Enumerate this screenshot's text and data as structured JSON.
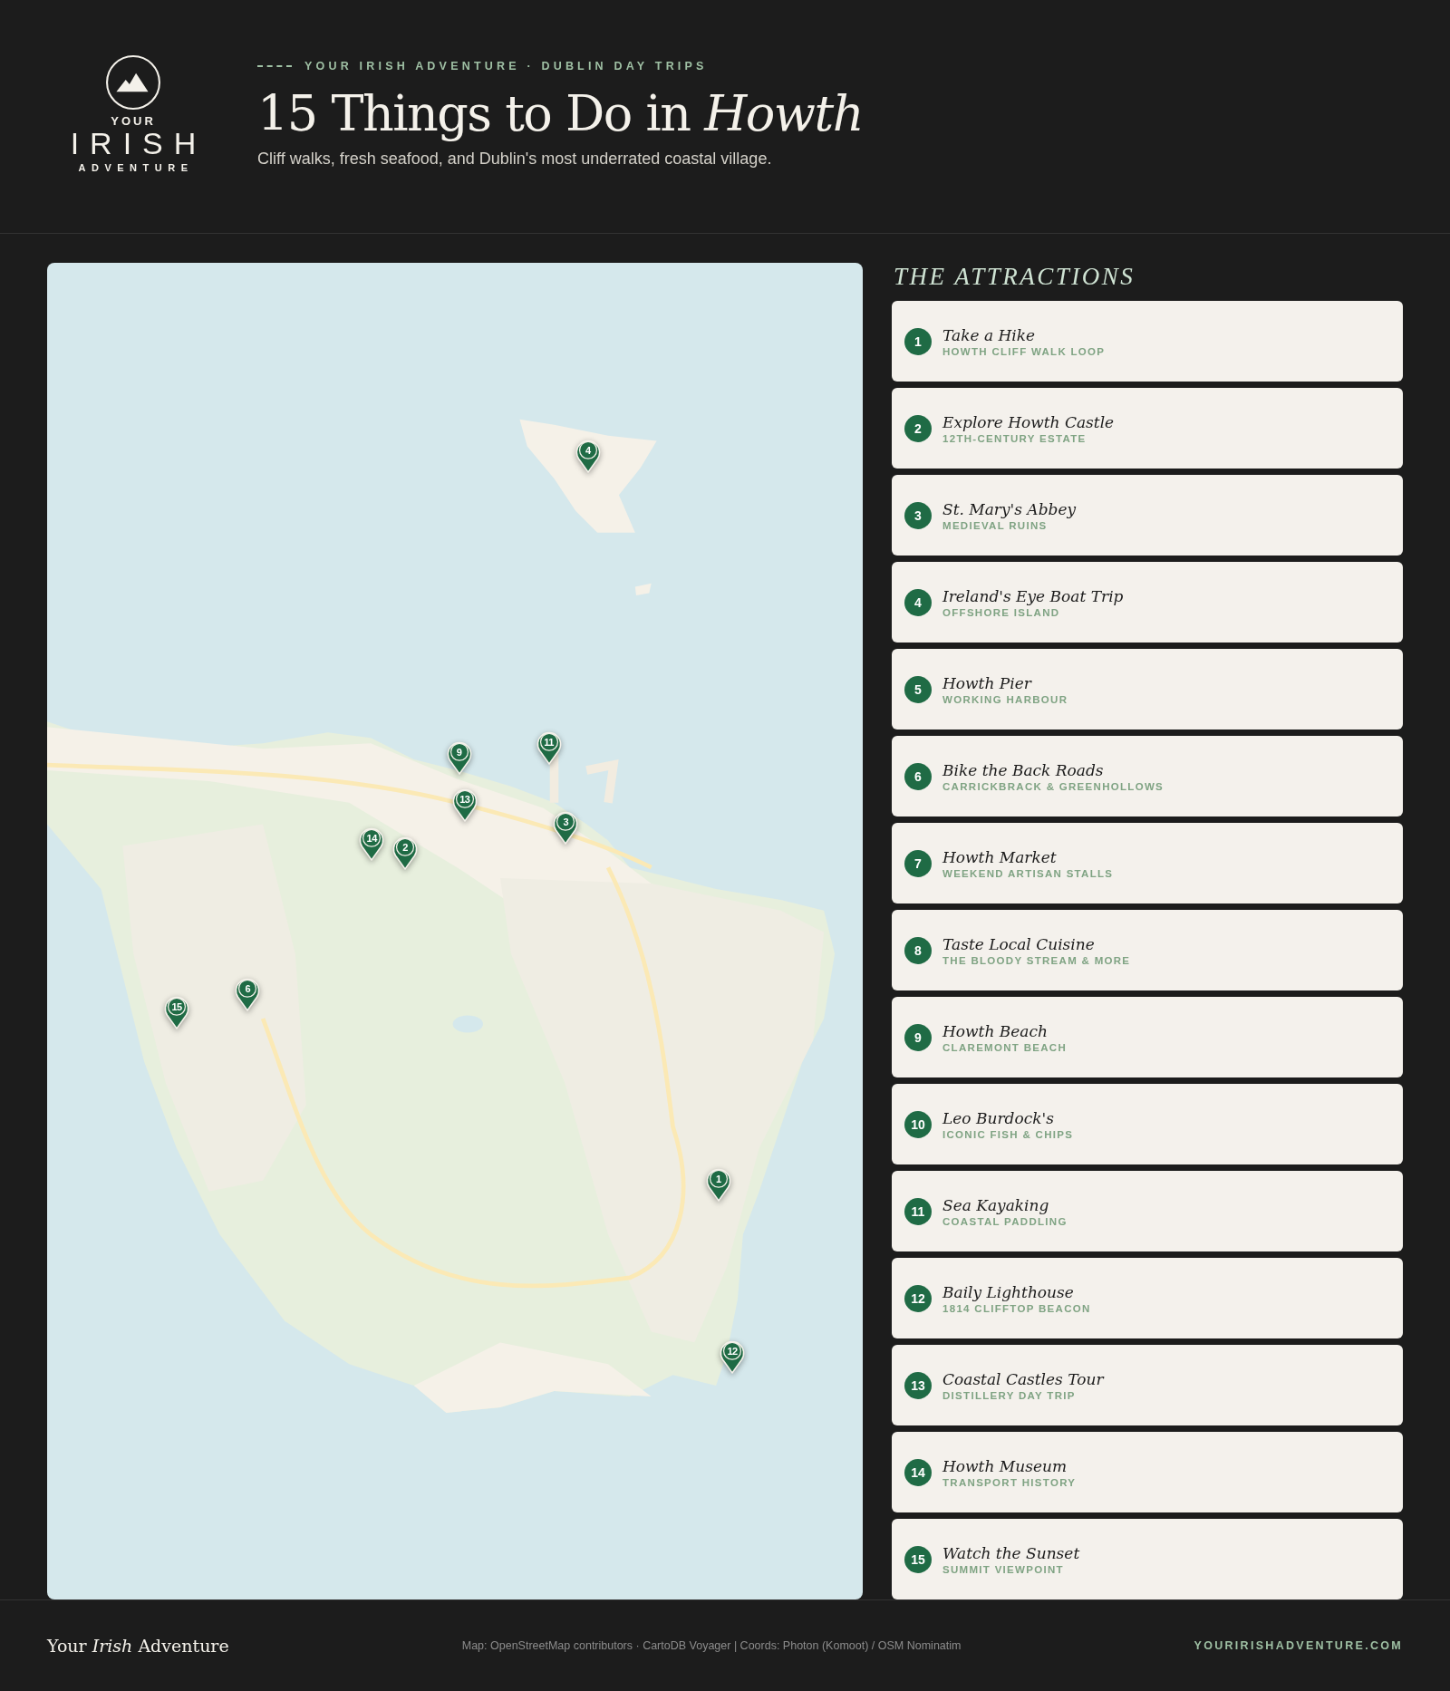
{
  "header": {
    "logo": {
      "top": "YOUR",
      "middle": "IRISH",
      "bottom": "ADVENTURE"
    },
    "eyebrow": "YOUR IRISH ADVENTURE · DUBLIN DAY TRIPS",
    "title": "15 Things to Do in *Howth*",
    "subtitle": "Cliff walks, fresh seafood, and Dublin's most underrated coastal village."
  },
  "map": {
    "kind": "picture",
    "pins": [
      {
        "label": "4"
      },
      {
        "label": "11"
      },
      {
        "label": "9"
      },
      {
        "label": "13"
      },
      {
        "label": "3"
      },
      {
        "label": "2"
      },
      {
        "label": "14"
      },
      {
        "label": "15"
      },
      {
        "label": "6"
      },
      {
        "label": "1"
      },
      {
        "label": "12"
      }
    ]
  },
  "attractions_heading": "THE ATTRACTIONS",
  "attractions": [
    {
      "number": "1",
      "name": "Take a Hike",
      "detail": "HOWTH CLIFF WALK LOOP"
    },
    {
      "number": "2",
      "name": "Explore Howth Castle",
      "detail": "12TH-CENTURY ESTATE"
    },
    {
      "number": "3",
      "name": "St. Mary's Abbey",
      "detail": "MEDIEVAL RUINS"
    },
    {
      "number": "4",
      "name": "Ireland's Eye Boat Trip",
      "detail": "OFFSHORE ISLAND"
    },
    {
      "number": "5",
      "name": "Howth Pier",
      "detail": "WORKING HARBOUR"
    },
    {
      "number": "6",
      "name": "Bike the Back Roads",
      "detail": "CARRICKBRACK & GREENHOLLOWS"
    },
    {
      "number": "7",
      "name": "Howth Market",
      "detail": "WEEKEND ARTISAN STALLS"
    },
    {
      "number": "8",
      "name": "Taste Local Cuisine",
      "detail": "THE BLOODY STREAM & MORE"
    },
    {
      "number": "9",
      "name": "Howth Beach",
      "detail": "CLAREMONT BEACH"
    },
    {
      "number": "10",
      "name": "Leo Burdock's",
      "detail": "ICONIC FISH & CHIPS"
    },
    {
      "number": "11",
      "name": "Sea Kayaking",
      "detail": "COASTAL PADDLING"
    },
    {
      "number": "12",
      "name": "Baily Lighthouse",
      "detail": "1814 CLIFFTOP BEACON"
    },
    {
      "number": "13",
      "name": "Coastal Castles Tour",
      "detail": "DISTILLERY DAY TRIP"
    },
    {
      "number": "14",
      "name": "Howth Museum",
      "detail": "TRANSPORT HISTORY"
    },
    {
      "number": "15",
      "name": "Watch the Sunset",
      "detail": "SUMMIT VIEWPOINT"
    }
  ],
  "footer": {
    "brand": "Your *Irish* Adventure",
    "credits": "Map: OpenStreetMap contributors · CartoDB Voyager | Coords: Photon (Komoot) / OSM Nominatim",
    "website": "YOURIRISHADVENTURE.COM"
  }
}
